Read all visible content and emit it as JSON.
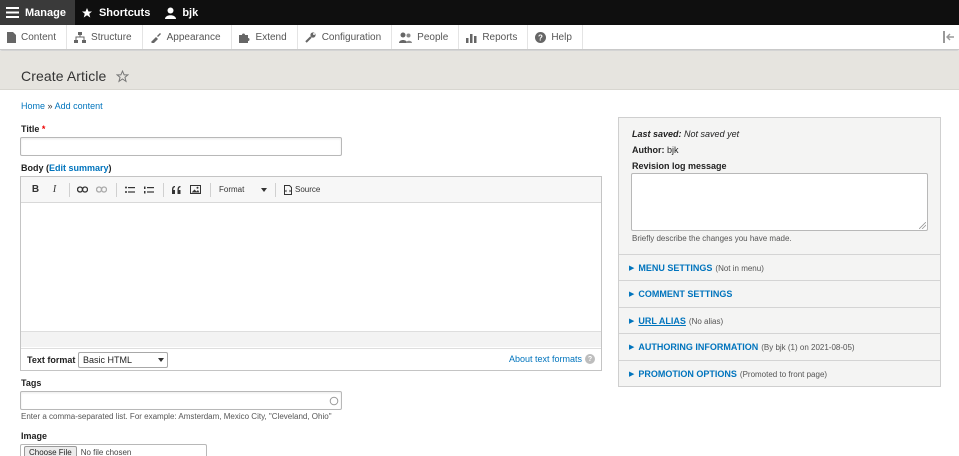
{
  "toolbar": {
    "manage": "Manage",
    "shortcuts": "Shortcuts",
    "user": "bjk"
  },
  "tray": {
    "items": [
      "Content",
      "Structure",
      "Appearance",
      "Extend",
      "Configuration",
      "People",
      "Reports",
      "Help"
    ]
  },
  "page": {
    "title": "Create Article"
  },
  "breadcrumb": {
    "home": "Home",
    "sep": "»",
    "add_content": "Add content"
  },
  "form": {
    "title_label": "Title",
    "required_mark": "*",
    "body_label": "Body",
    "body_paren_open": "(",
    "edit_summary": "Edit summary",
    "body_paren_close": ")",
    "editor": {
      "bold": "B",
      "italic": "I",
      "format": "Format",
      "source": "Source"
    },
    "text_format_label": "Text format",
    "text_format_value": "Basic HTML",
    "about_formats": "About text formats",
    "tags_label": "Tags",
    "tags_desc": "Enter a comma-separated list. For example: Amsterdam, Mexico City, \"Cleveland, Ohio\"",
    "image_label": "Image",
    "choose_file": "Choose File",
    "no_file": "No file chosen"
  },
  "sidebar": {
    "last_saved_label": "Last saved:",
    "last_saved_value": "Not saved yet",
    "author_label": "Author:",
    "author_value": "bjk",
    "revision_label": "Revision log message",
    "revision_desc": "Briefly describe the changes you have made.",
    "sections": [
      {
        "title": "MENU SETTINGS",
        "summary": "(Not in menu)"
      },
      {
        "title": "COMMENT SETTINGS",
        "summary": ""
      },
      {
        "title": "URL ALIAS",
        "summary": "(No alias)"
      },
      {
        "title": "AUTHORING INFORMATION",
        "summary": "(By bjk (1) on 2021-08-05)"
      },
      {
        "title": "PROMOTION OPTIONS",
        "summary": "(Promoted to front page)"
      }
    ]
  },
  "colors": {
    "link": "#0074bd",
    "toolbar_bg": "#0f0f0f",
    "header_bg": "#e6e4df"
  }
}
